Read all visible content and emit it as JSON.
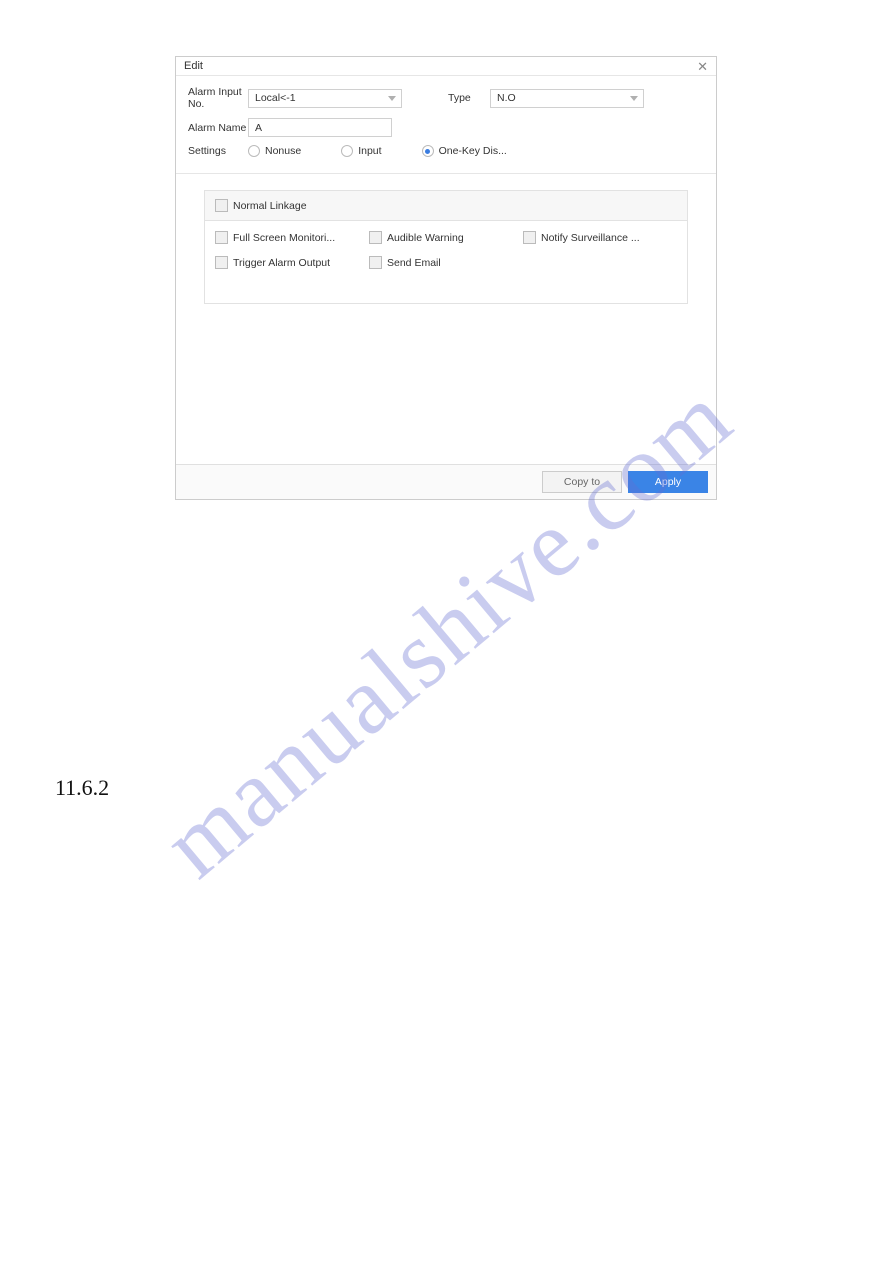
{
  "dialog": {
    "title": "Edit",
    "fields": {
      "alarm_input_no_label": "Alarm Input No.",
      "alarm_input_no_value": "Local<-1",
      "type_label": "Type",
      "type_value": "N.O",
      "alarm_name_label": "Alarm Name",
      "alarm_name_value": "A",
      "settings_label": "Settings"
    },
    "settings_options": {
      "nonuse": "Nonuse",
      "input": "Input",
      "onekey": "One-Key Dis..."
    },
    "linkage": {
      "header": "Normal Linkage",
      "full_screen": "Full Screen Monitori...",
      "audible": "Audible Warning",
      "notify": "Notify Surveillance ...",
      "trigger": "Trigger Alarm Output",
      "email": "Send Email"
    },
    "buttons": {
      "copy": "Copy to",
      "apply": "Apply"
    }
  },
  "watermark": "manualshive.com",
  "section_number": "11.6.2"
}
